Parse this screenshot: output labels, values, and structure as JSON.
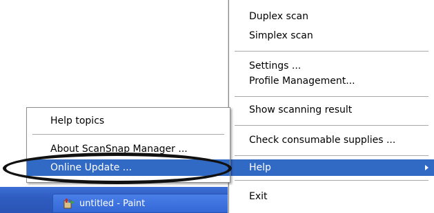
{
  "taskbar": {
    "task_button_label": "untitled - Paint"
  },
  "main_menu": {
    "items": [
      {
        "label": "Duplex scan"
      },
      {
        "label": "Simplex scan"
      },
      {
        "label": "Settings ..."
      },
      {
        "label": "Profile Management..."
      },
      {
        "label": "Show scanning result"
      },
      {
        "label": "Check consumable supplies ..."
      },
      {
        "label": "Help"
      },
      {
        "label": "Exit"
      }
    ]
  },
  "help_submenu": {
    "items": [
      {
        "label": "Help topics"
      },
      {
        "label": "About ScanSnap Manager ..."
      },
      {
        "label": "Online Update ..."
      }
    ]
  },
  "colors": {
    "highlight": "#316ac5",
    "taskbar": "#2f5cc0"
  }
}
